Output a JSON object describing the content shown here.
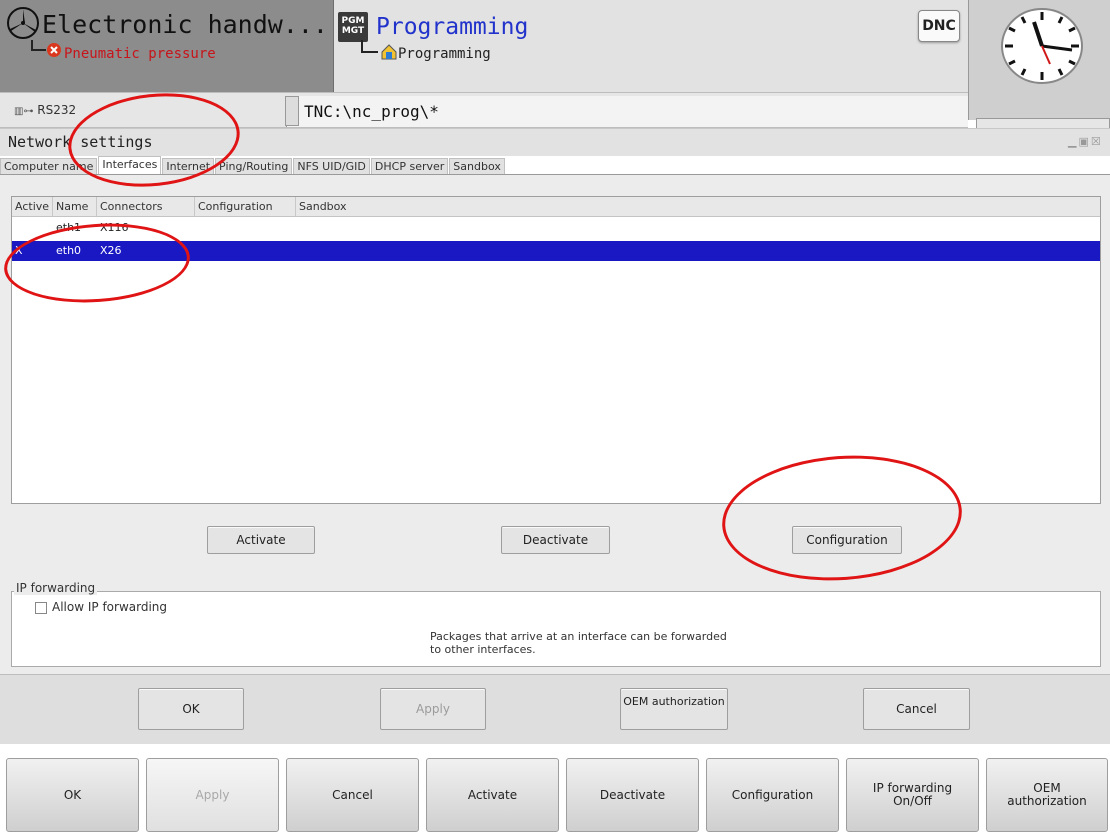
{
  "header": {
    "mode1_title": "Electronic handw...",
    "mode1_error": "Pneumatic pressure",
    "mode2_title": "Programming",
    "mode2_sub": "Programming",
    "pgm_badge_line1": "PGM",
    "pgm_badge_line2": "MGT",
    "dnc_badge": "DNC",
    "interface_label": "RS232",
    "path": "TNC:\\nc_prog\\*"
  },
  "dialog": {
    "title": "Network settings",
    "tabs": [
      {
        "label": "Computer name"
      },
      {
        "label": "Interfaces"
      },
      {
        "label": "Internet"
      },
      {
        "label": "Ping/Routing"
      },
      {
        "label": "NFS UID/GID"
      },
      {
        "label": "DHCP server"
      },
      {
        "label": "Sandbox"
      }
    ],
    "active_tab": "Interfaces",
    "table": {
      "columns": [
        "Active",
        "Name",
        "Connectors",
        "Configuration",
        "Sandbox"
      ],
      "rows": [
        {
          "active": "",
          "name": "eth1",
          "connector": "X116",
          "configuration": "",
          "sandbox": ""
        },
        {
          "active": "X",
          "name": "eth0",
          "connector": "X26",
          "configuration": "",
          "sandbox": ""
        }
      ],
      "selected_row": 1
    },
    "buttons": {
      "activate": "Activate",
      "deactivate": "Deactivate",
      "configuration": "Configuration"
    },
    "ip_forwarding": {
      "group_label": "IP forwarding",
      "checkbox_label": "Allow IP forwarding",
      "checked": false,
      "note": "Packages that arrive at an interface can be forwarded to other interfaces."
    },
    "footer_buttons": {
      "ok": "OK",
      "apply": "Apply",
      "oem": "OEM authorization",
      "cancel": "Cancel"
    }
  },
  "softkeys": [
    {
      "label": "OK",
      "enabled": true
    },
    {
      "label": "Apply",
      "enabled": false
    },
    {
      "label": "Cancel",
      "enabled": true
    },
    {
      "label": "Activate",
      "enabled": true
    },
    {
      "label": "Deactivate",
      "enabled": true
    },
    {
      "label": "Configuration",
      "enabled": true
    },
    {
      "label": "IP forwarding\nOn/Off",
      "enabled": true
    },
    {
      "label": "OEM\nauthorization",
      "enabled": true
    }
  ],
  "colors": {
    "selection": "#1a18c2",
    "error": "#c8141a",
    "mode_title": "#2233cc",
    "annotation": "#e01414"
  }
}
